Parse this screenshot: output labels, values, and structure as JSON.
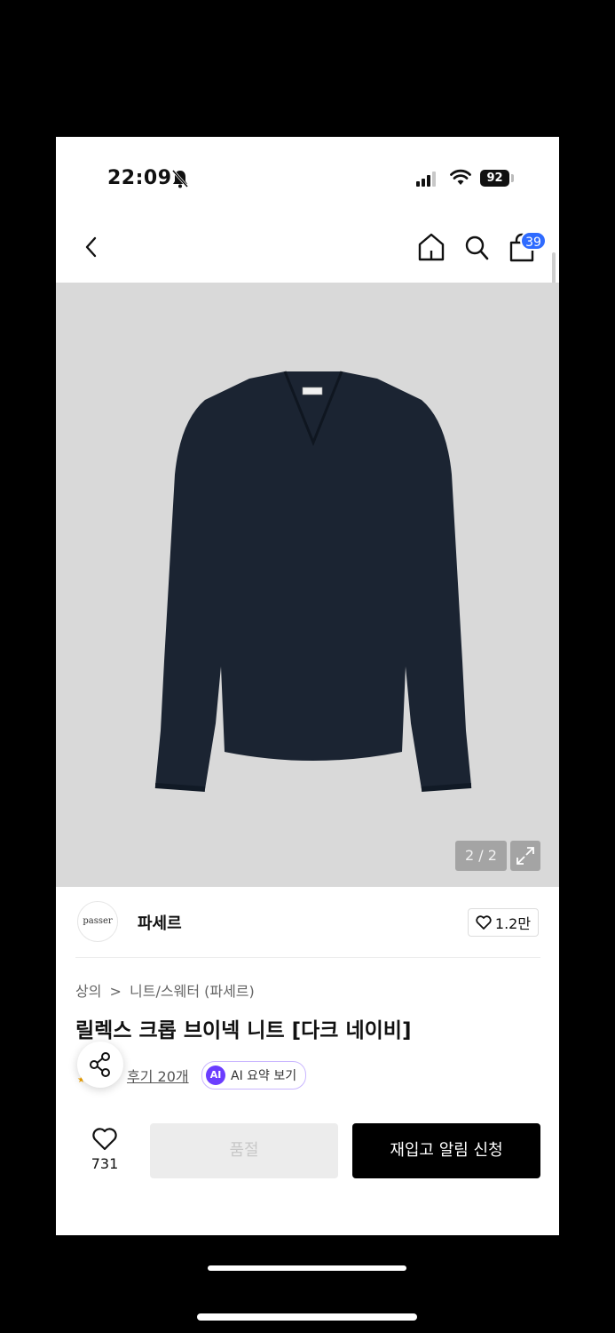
{
  "status_bar": {
    "time": "22:09",
    "battery": "92",
    "icons": [
      "bell-off-icon",
      "signal-icon",
      "wifi-icon",
      "battery-icon"
    ]
  },
  "nav": {
    "icons": [
      "chevron-left-icon",
      "home-icon",
      "search-icon",
      "cart-icon"
    ],
    "cart_count": "39"
  },
  "gallery": {
    "counter": "2 / 2",
    "icon": "expand-icon"
  },
  "brand": {
    "logo_text": "passer",
    "name": "파세르",
    "likes": "1.2만",
    "icon": "heart-outline-icon"
  },
  "breadcrumb": {
    "category": "상의",
    "separator": ">",
    "subcategory": "니트/스웨터 (파세르)"
  },
  "product": {
    "title": "릴렉스 크롭 브이넥 니트 [다크 네이비]",
    "review_link": "후기 20개",
    "ai_badge": "AI",
    "ai_summary": "AI 요약 보기"
  },
  "bottom_bar": {
    "wish_count": "731",
    "soldout_label": "품절",
    "restock_label": "재입고 알림 신청"
  },
  "colors": {
    "accent_blue": "#2f6bff",
    "ai_purple": "#6b3dff",
    "sweater_navy": "#1b2432"
  }
}
